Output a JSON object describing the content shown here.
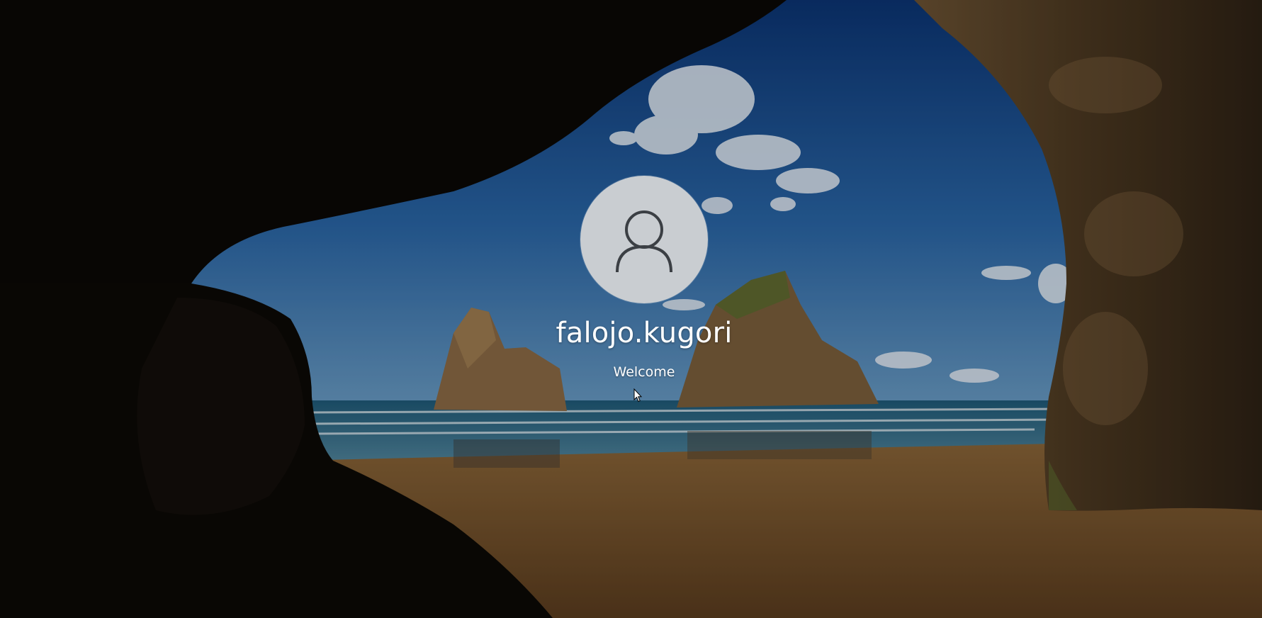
{
  "login": {
    "username": "falojo.kugori",
    "status": "Welcome",
    "avatar_icon": "user-icon"
  },
  "wallpaper": {
    "icon": "cave-beach-wallpaper",
    "colors": {
      "sky_top": "#0d3a78",
      "sky_bottom": "#3f7fb7",
      "sea": "#2e6b86",
      "sand": "#7a5630",
      "rock": "#1a130d"
    }
  },
  "cursor": {
    "icon": "arrow-cursor-icon"
  }
}
